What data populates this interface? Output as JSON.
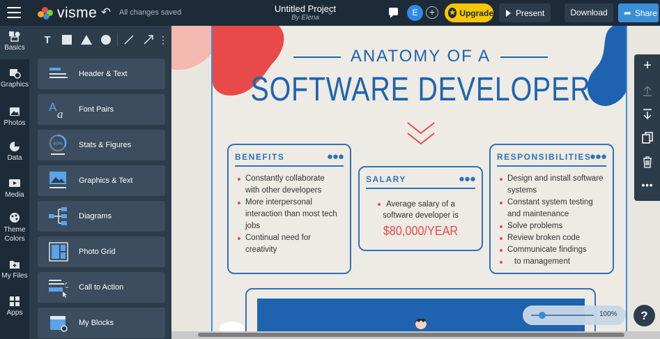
{
  "header": {
    "app_name": "visme",
    "save_status": "All changes saved",
    "project_title": "Untitled Project",
    "project_author": "By Elena",
    "avatar_initial": "E",
    "upgrade_label": "Upgrade",
    "present_label": "Present",
    "download_label": "Download",
    "share_label": "Share"
  },
  "rail": {
    "items": [
      {
        "label": "Basics",
        "icon": "shapes-icon"
      },
      {
        "label": "Graphics",
        "icon": "graphics-icon"
      },
      {
        "label": "Photos",
        "icon": "photo-icon"
      },
      {
        "label": "Data",
        "icon": "pie-chart-icon"
      },
      {
        "label": "Media",
        "icon": "media-icon"
      },
      {
        "label": "Theme",
        "label2": "Colors",
        "icon": "palette-icon"
      },
      {
        "label": "My Files",
        "icon": "folder-icon"
      },
      {
        "label": "Apps",
        "icon": "apps-grid-icon"
      }
    ]
  },
  "panel": {
    "tools": [
      "text-tool-icon",
      "square-tool-icon",
      "triangle-tool-icon",
      "circle-tool-icon",
      "line-tool-icon",
      "arrow-tool-icon",
      "more-vertical-icon"
    ],
    "cards": [
      {
        "label": "Header & Text",
        "icon": "header-text-icon"
      },
      {
        "label": "Font Pairs",
        "icon": "font-pairs-icon"
      },
      {
        "label": "Stats & Figures",
        "icon": "stats-icon",
        "icon_text": "40%"
      },
      {
        "label": "Graphics & Text",
        "icon": "graphics-text-icon"
      },
      {
        "label": "Diagrams",
        "icon": "diagram-icon"
      },
      {
        "label": "Photo Grid",
        "icon": "photo-grid-icon"
      },
      {
        "label": "Call to Action",
        "icon": "call-to-action-icon"
      },
      {
        "label": "My Blocks",
        "icon": "my-blocks-icon"
      }
    ]
  },
  "infographic": {
    "title_small": "ANATOMY OF A",
    "title_large": "SOFTWARE DEVELOPER",
    "benefits": {
      "heading": "BENEFITS",
      "items": [
        "Constantly collaborate with other developers",
        "More interpersonal interaction than most tech jobs",
        "Continual need for creativity"
      ]
    },
    "salary": {
      "heading": "SALARY",
      "text": "Average salary of a software developer is",
      "amount": "$80,000/YEAR"
    },
    "responsibilities": {
      "heading": "RESPONSIBILITIES",
      "items": [
        "Design and install software systems",
        "Constant system testing and maintenance",
        "Solve problems",
        "Review broken code",
        "Communicate findings",
        "to management"
      ]
    }
  },
  "zoom": {
    "value": "100%",
    "level": 0.15
  },
  "help": {
    "label": "?"
  },
  "colors": {
    "accent": "#3a8fd8",
    "brand_blue": "#1e63b0",
    "salary_red": "#e84a4a",
    "upgrade_yellow": "#f7c600"
  }
}
